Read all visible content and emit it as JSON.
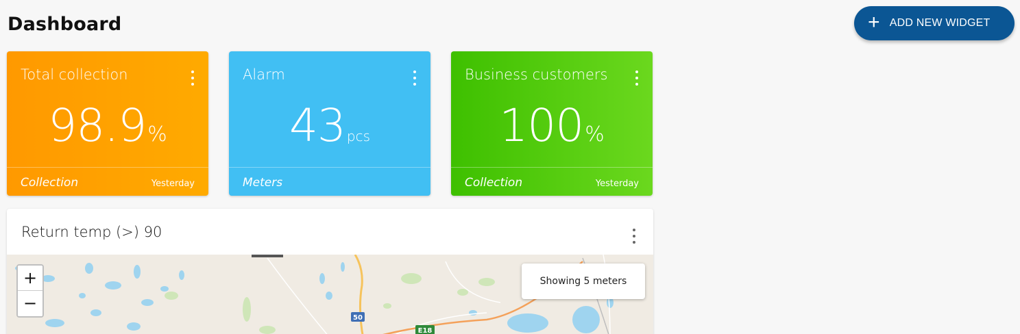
{
  "header": {
    "title": "Dashboard",
    "add_widget_label": "ADD NEW WIDGET",
    "add_widget_icon": "plus-icon"
  },
  "cards": [
    {
      "title": "Total collection",
      "value": "98.9",
      "unit": "%",
      "footer_left": "Collection",
      "footer_right": "Yesterday",
      "color": "#ffa200"
    },
    {
      "title": "Alarm",
      "value": "43",
      "unit": "pcs",
      "footer_left": "Meters",
      "footer_right": "",
      "color": "#41bff3"
    },
    {
      "title": "Business customers",
      "value": "100",
      "unit": "%",
      "footer_left": "Collection",
      "footer_right": "Yesterday",
      "color": "#52cc10"
    }
  ],
  "map_widget": {
    "title": "Return temp (>) 90",
    "zoom_in_label": "+",
    "zoom_out_label": "−",
    "status": "Showing 5 meters",
    "road_labels": [
      "50",
      "E18"
    ]
  },
  "colors": {
    "accent": "#0b5694",
    "background": "#f7f7f7"
  }
}
